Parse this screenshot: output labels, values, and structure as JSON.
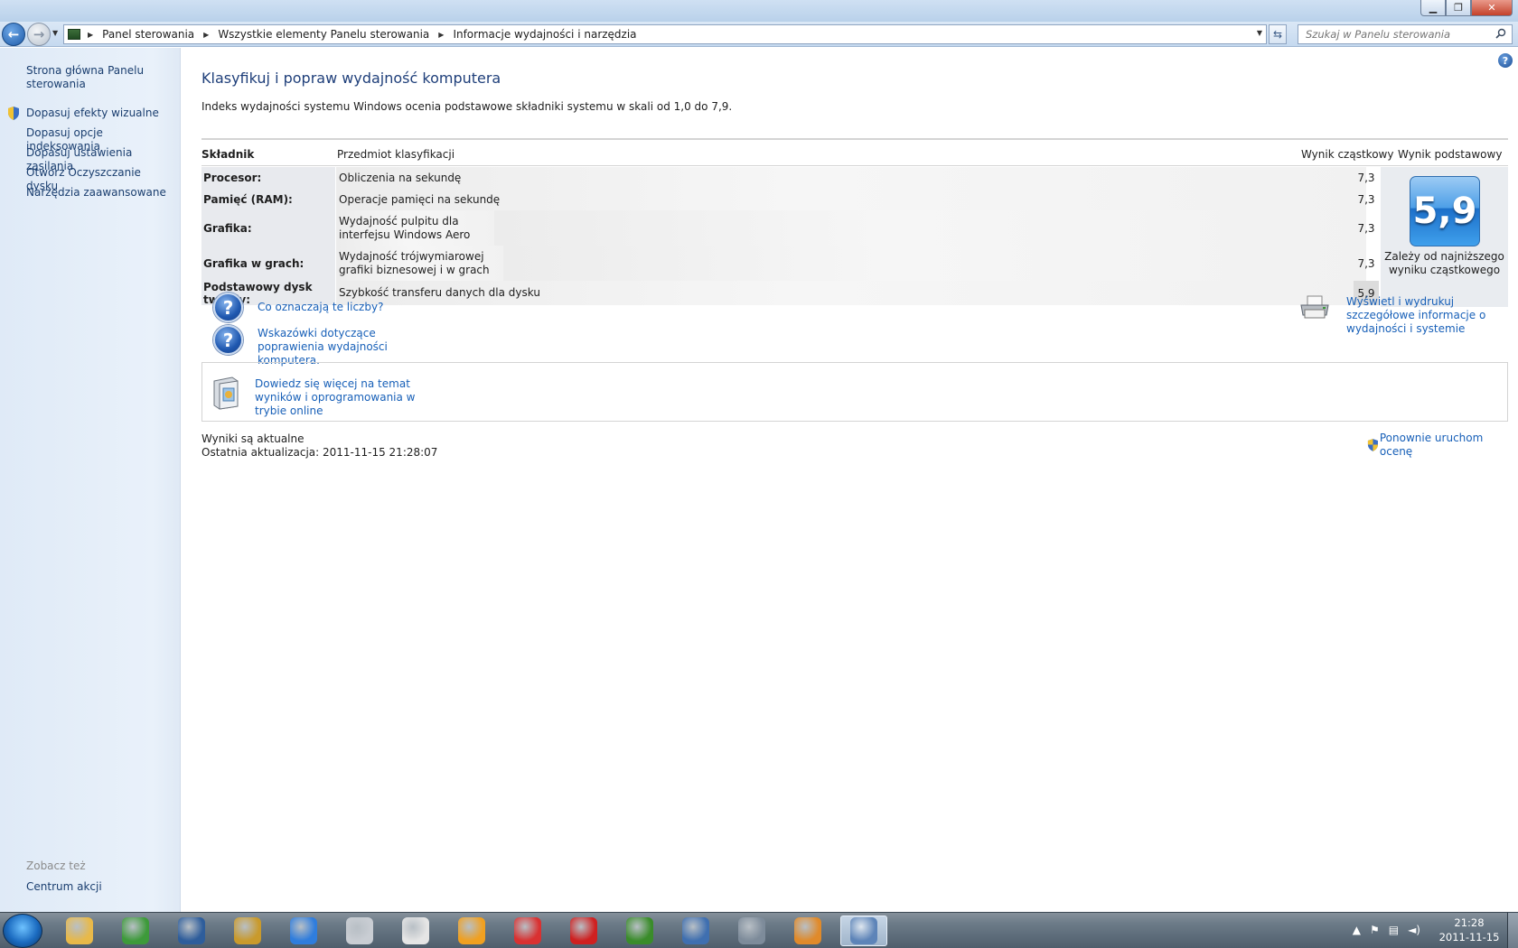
{
  "window": {
    "minimize_glyph": "▁",
    "maximize_glyph": "❐",
    "close_glyph": "✕"
  },
  "nav": {
    "breadcrumbs": [
      "Panel sterowania",
      "Wszystkie elementy Panelu sterowania",
      "Informacje wydajności i narzędzia"
    ],
    "search_placeholder": "Szukaj w Panelu sterowania"
  },
  "sidebar": {
    "items": [
      {
        "label": "Strona główna Panelu sterowania"
      },
      {
        "label": "Dopasuj efekty wizualne"
      },
      {
        "label": "Dopasuj opcje indeksowania"
      },
      {
        "label": "Dopasuj ustawienia zasilania"
      },
      {
        "label": "Otwórz Oczyszczanie dysku"
      },
      {
        "label": "Narzędzia zaawansowane"
      }
    ],
    "see_also_label": "Zobacz też",
    "see_also_items": [
      {
        "label": "Centrum akcji"
      }
    ]
  },
  "main": {
    "title": "Klasyfikuj i popraw wydajność komputera",
    "description": "Indeks wydajności systemu Windows ocenia podstawowe składniki systemu w skali od 1,0 do 7,9.",
    "table": {
      "headers": {
        "component": "Składnik",
        "subject": "Przedmiot klasyfikacji",
        "subscore": "Wynik cząstkowy",
        "basescore": "Wynik podstawowy"
      },
      "rows": [
        {
          "component": "Procesor:",
          "subject": "Obliczenia na sekundę",
          "subscore": "7,3"
        },
        {
          "component": "Pamięć (RAM):",
          "subject": "Operacje pamięci na sekundę",
          "subscore": "7,3"
        },
        {
          "component": "Grafika:",
          "subject": "Wydajność pulpitu dla interfejsu Windows Aero",
          "subscore": "7,3"
        },
        {
          "component": "Grafika w grach:",
          "subject": "Wydajność trójwymiarowej grafiki biznesowej i w grach",
          "subscore": "7,3"
        },
        {
          "component": "Podstawowy dysk twardy:",
          "subject": "Szybkość transferu danych dla dysku",
          "subscore": "5,9"
        }
      ],
      "base_score": "5,9",
      "base_note": "Zależy od najniższego wyniku cząstkowego"
    },
    "links": {
      "what_numbers_mean": "Co oznaczają te liczby?",
      "tips": "Wskazówki dotyczące poprawienia wydajności komputera.",
      "print_details": "Wyświetl i wydrukuj szczegółowe informacje o wydajności i systemie",
      "learn_more": "Dowiedz się więcej na temat wyników i oprogramowania w trybie online",
      "rerun": "Ponownie uruchom ocenę"
    },
    "status": {
      "current": "Wyniki są aktualne",
      "last_update": "Ostatnia aktualizacja: 2011-11-15 21:28:07"
    }
  },
  "taskbar": {
    "apps": [
      {
        "name": "explorer",
        "color": "#e8b949"
      },
      {
        "name": "utorrent",
        "color": "#3d9a3a"
      },
      {
        "name": "app-x",
        "color": "#2e5d9b"
      },
      {
        "name": "video-editor",
        "color": "#c99a2c"
      },
      {
        "name": "thunder",
        "color": "#2f7ddd"
      },
      {
        "name": "dvd",
        "color": "#c9cdd3"
      },
      {
        "name": "foxit",
        "color": "#e5e5e5"
      },
      {
        "name": "smiley",
        "color": "#f0a020"
      },
      {
        "name": "flash",
        "color": "#d93131"
      },
      {
        "name": "red-splat",
        "color": "#cf2020"
      },
      {
        "name": "green-app",
        "color": "#3a8c2a"
      },
      {
        "name": "thunderbird",
        "color": "#3f6fb0"
      },
      {
        "name": "winamp",
        "color": "#7d8b9a"
      },
      {
        "name": "media-player",
        "color": "#e08a2a"
      },
      {
        "name": "control-panel",
        "color": "#5d84b8"
      }
    ],
    "time": "21:28",
    "date": "2011-11-15"
  }
}
